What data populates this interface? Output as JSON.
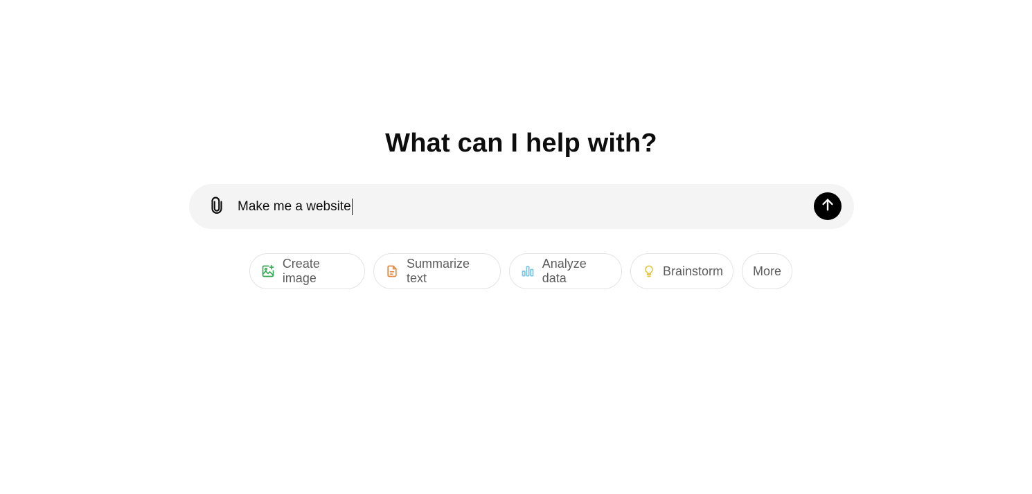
{
  "main": {
    "heading": "What can I help with?"
  },
  "composer": {
    "input_value": "Make me a website",
    "attach_icon": "paperclip-icon",
    "send_icon": "arrow-up-icon"
  },
  "suggestions": [
    {
      "label": "Create image",
      "icon": "image-sparkle-icon",
      "color": "#35a853"
    },
    {
      "label": "Summarize text",
      "icon": "document-icon",
      "color": "#e4883e"
    },
    {
      "label": "Analyze data",
      "icon": "bar-chart-icon",
      "color": "#76c5e6"
    },
    {
      "label": "Brainstorm",
      "icon": "lightbulb-icon",
      "color": "#e2c541"
    },
    {
      "label": "More"
    }
  ]
}
